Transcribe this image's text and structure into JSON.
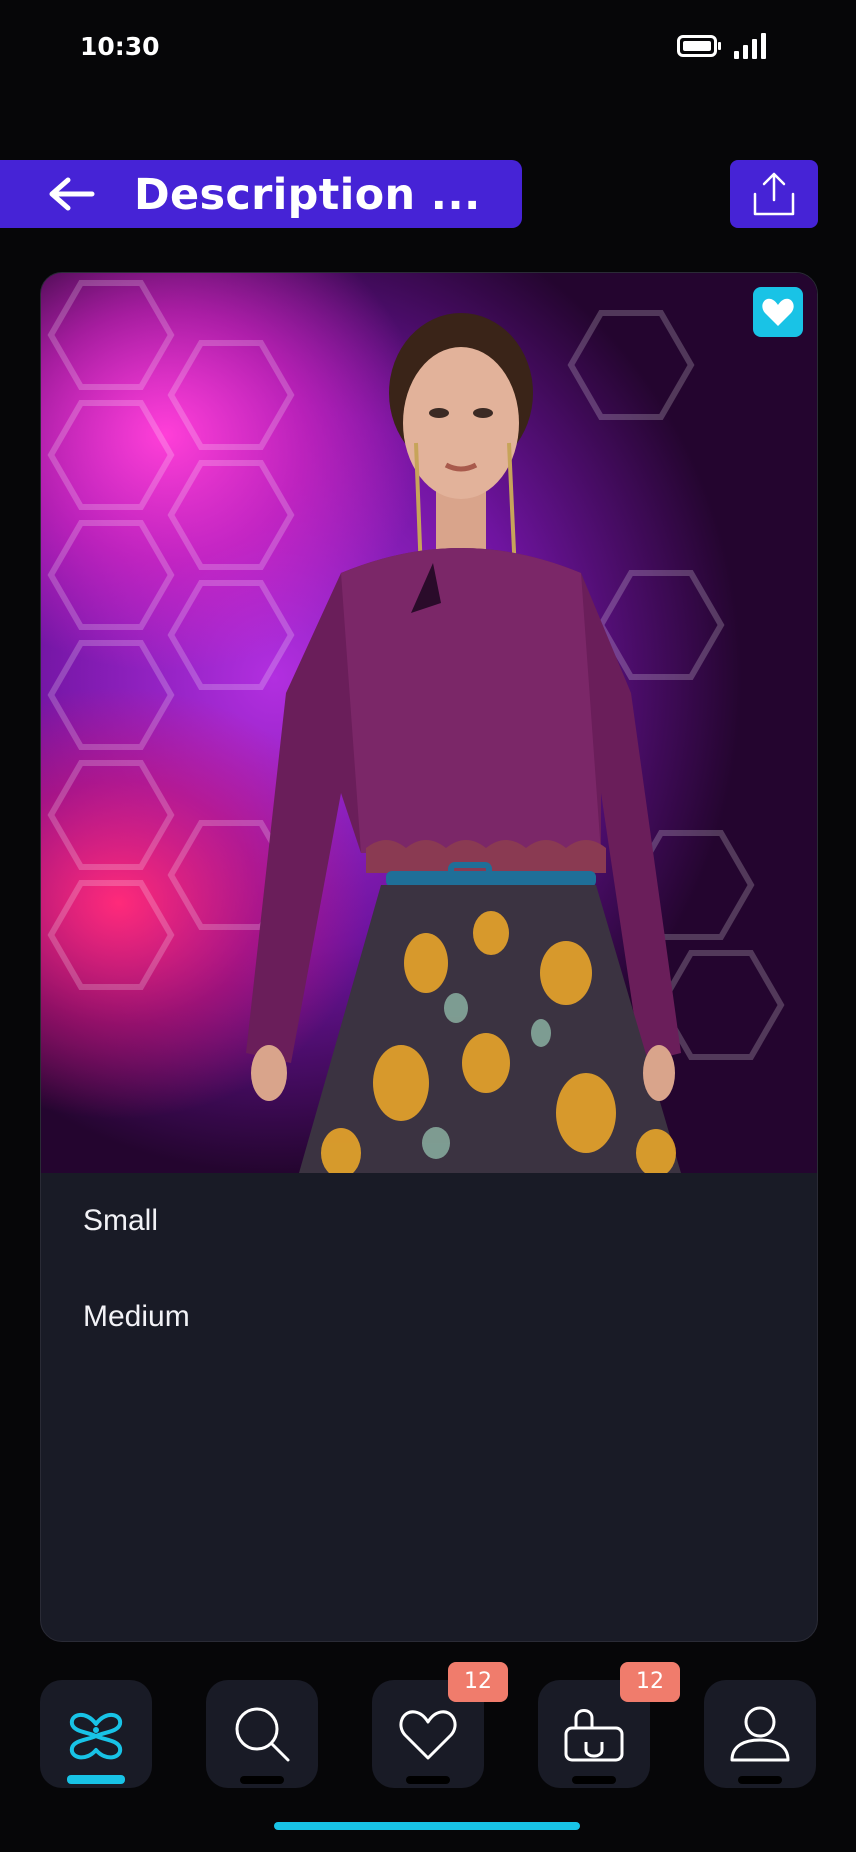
{
  "status_bar": {
    "time": "10:30"
  },
  "header": {
    "title": "Description ..."
  },
  "product": {
    "sizes": [
      "Small",
      "Medium"
    ]
  },
  "nav": {
    "items": [
      {
        "name": "home",
        "active": true
      },
      {
        "name": "search"
      },
      {
        "name": "wishlist",
        "badge": "12"
      },
      {
        "name": "cart",
        "badge": "12"
      },
      {
        "name": "profile"
      }
    ]
  },
  "colors": {
    "accent": "#4623d6",
    "highlight": "#18c3e6",
    "badge": "#f07c6c",
    "card": "#191b26",
    "background": "#060608"
  }
}
